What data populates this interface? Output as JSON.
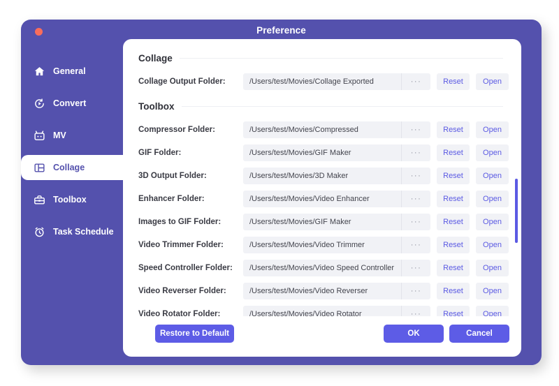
{
  "window": {
    "title": "Preference",
    "close_button": "close",
    "accent_purple": "#5451ad",
    "accent_indigo": "#5d5ce6",
    "close_color": "#f96d5b"
  },
  "sidebar": {
    "items": [
      {
        "label": "General",
        "icon": "home-icon",
        "active": false
      },
      {
        "label": "Convert",
        "icon": "convert-icon",
        "active": false
      },
      {
        "label": "MV",
        "icon": "mv-icon",
        "active": false
      },
      {
        "label": "Collage",
        "icon": "collage-icon",
        "active": true
      },
      {
        "label": "Toolbox",
        "icon": "toolbox-icon",
        "active": false
      },
      {
        "label": "Task Schedule",
        "icon": "clock-icon",
        "active": false
      }
    ]
  },
  "main": {
    "sections": [
      {
        "title": "Collage",
        "rows": [
          {
            "label": "Collage Output Folder:",
            "value": "/Users/test/Movies/Collage Exported",
            "browse": "···",
            "reset": "Reset",
            "open": "Open"
          }
        ]
      },
      {
        "title": "Toolbox",
        "rows": [
          {
            "label": "Compressor Folder:",
            "value": "/Users/test/Movies/Compressed",
            "browse": "···",
            "reset": "Reset",
            "open": "Open"
          },
          {
            "label": "GIF Folder:",
            "value": "/Users/test/Movies/GIF Maker",
            "browse": "···",
            "reset": "Reset",
            "open": "Open"
          },
          {
            "label": "3D Output Folder:",
            "value": "/Users/test/Movies/3D Maker",
            "browse": "···",
            "reset": "Reset",
            "open": "Open"
          },
          {
            "label": "Enhancer Folder:",
            "value": "/Users/test/Movies/Video Enhancer",
            "browse": "···",
            "reset": "Reset",
            "open": "Open"
          },
          {
            "label": "Images to GIF Folder:",
            "value": "/Users/test/Movies/GIF Maker",
            "browse": "···",
            "reset": "Reset",
            "open": "Open"
          },
          {
            "label": "Video Trimmer Folder:",
            "value": "/Users/test/Movies/Video Trimmer",
            "browse": "···",
            "reset": "Reset",
            "open": "Open"
          },
          {
            "label": "Speed Controller Folder:",
            "value": "/Users/test/Movies/Video Speed Controller",
            "browse": "···",
            "reset": "Reset",
            "open": "Open"
          },
          {
            "label": "Video Reverser Folder:",
            "value": "/Users/test/Movies/Video Reverser",
            "browse": "···",
            "reset": "Reset",
            "open": "Open"
          },
          {
            "label": "Video Rotator Folder:",
            "value": "/Users/test/Movies/Video Rotator",
            "browse": "···",
            "reset": "Reset",
            "open": "Open"
          }
        ]
      }
    ]
  },
  "footer": {
    "restore_label": "Restore to Default",
    "ok_label": "OK",
    "cancel_label": "Cancel"
  }
}
